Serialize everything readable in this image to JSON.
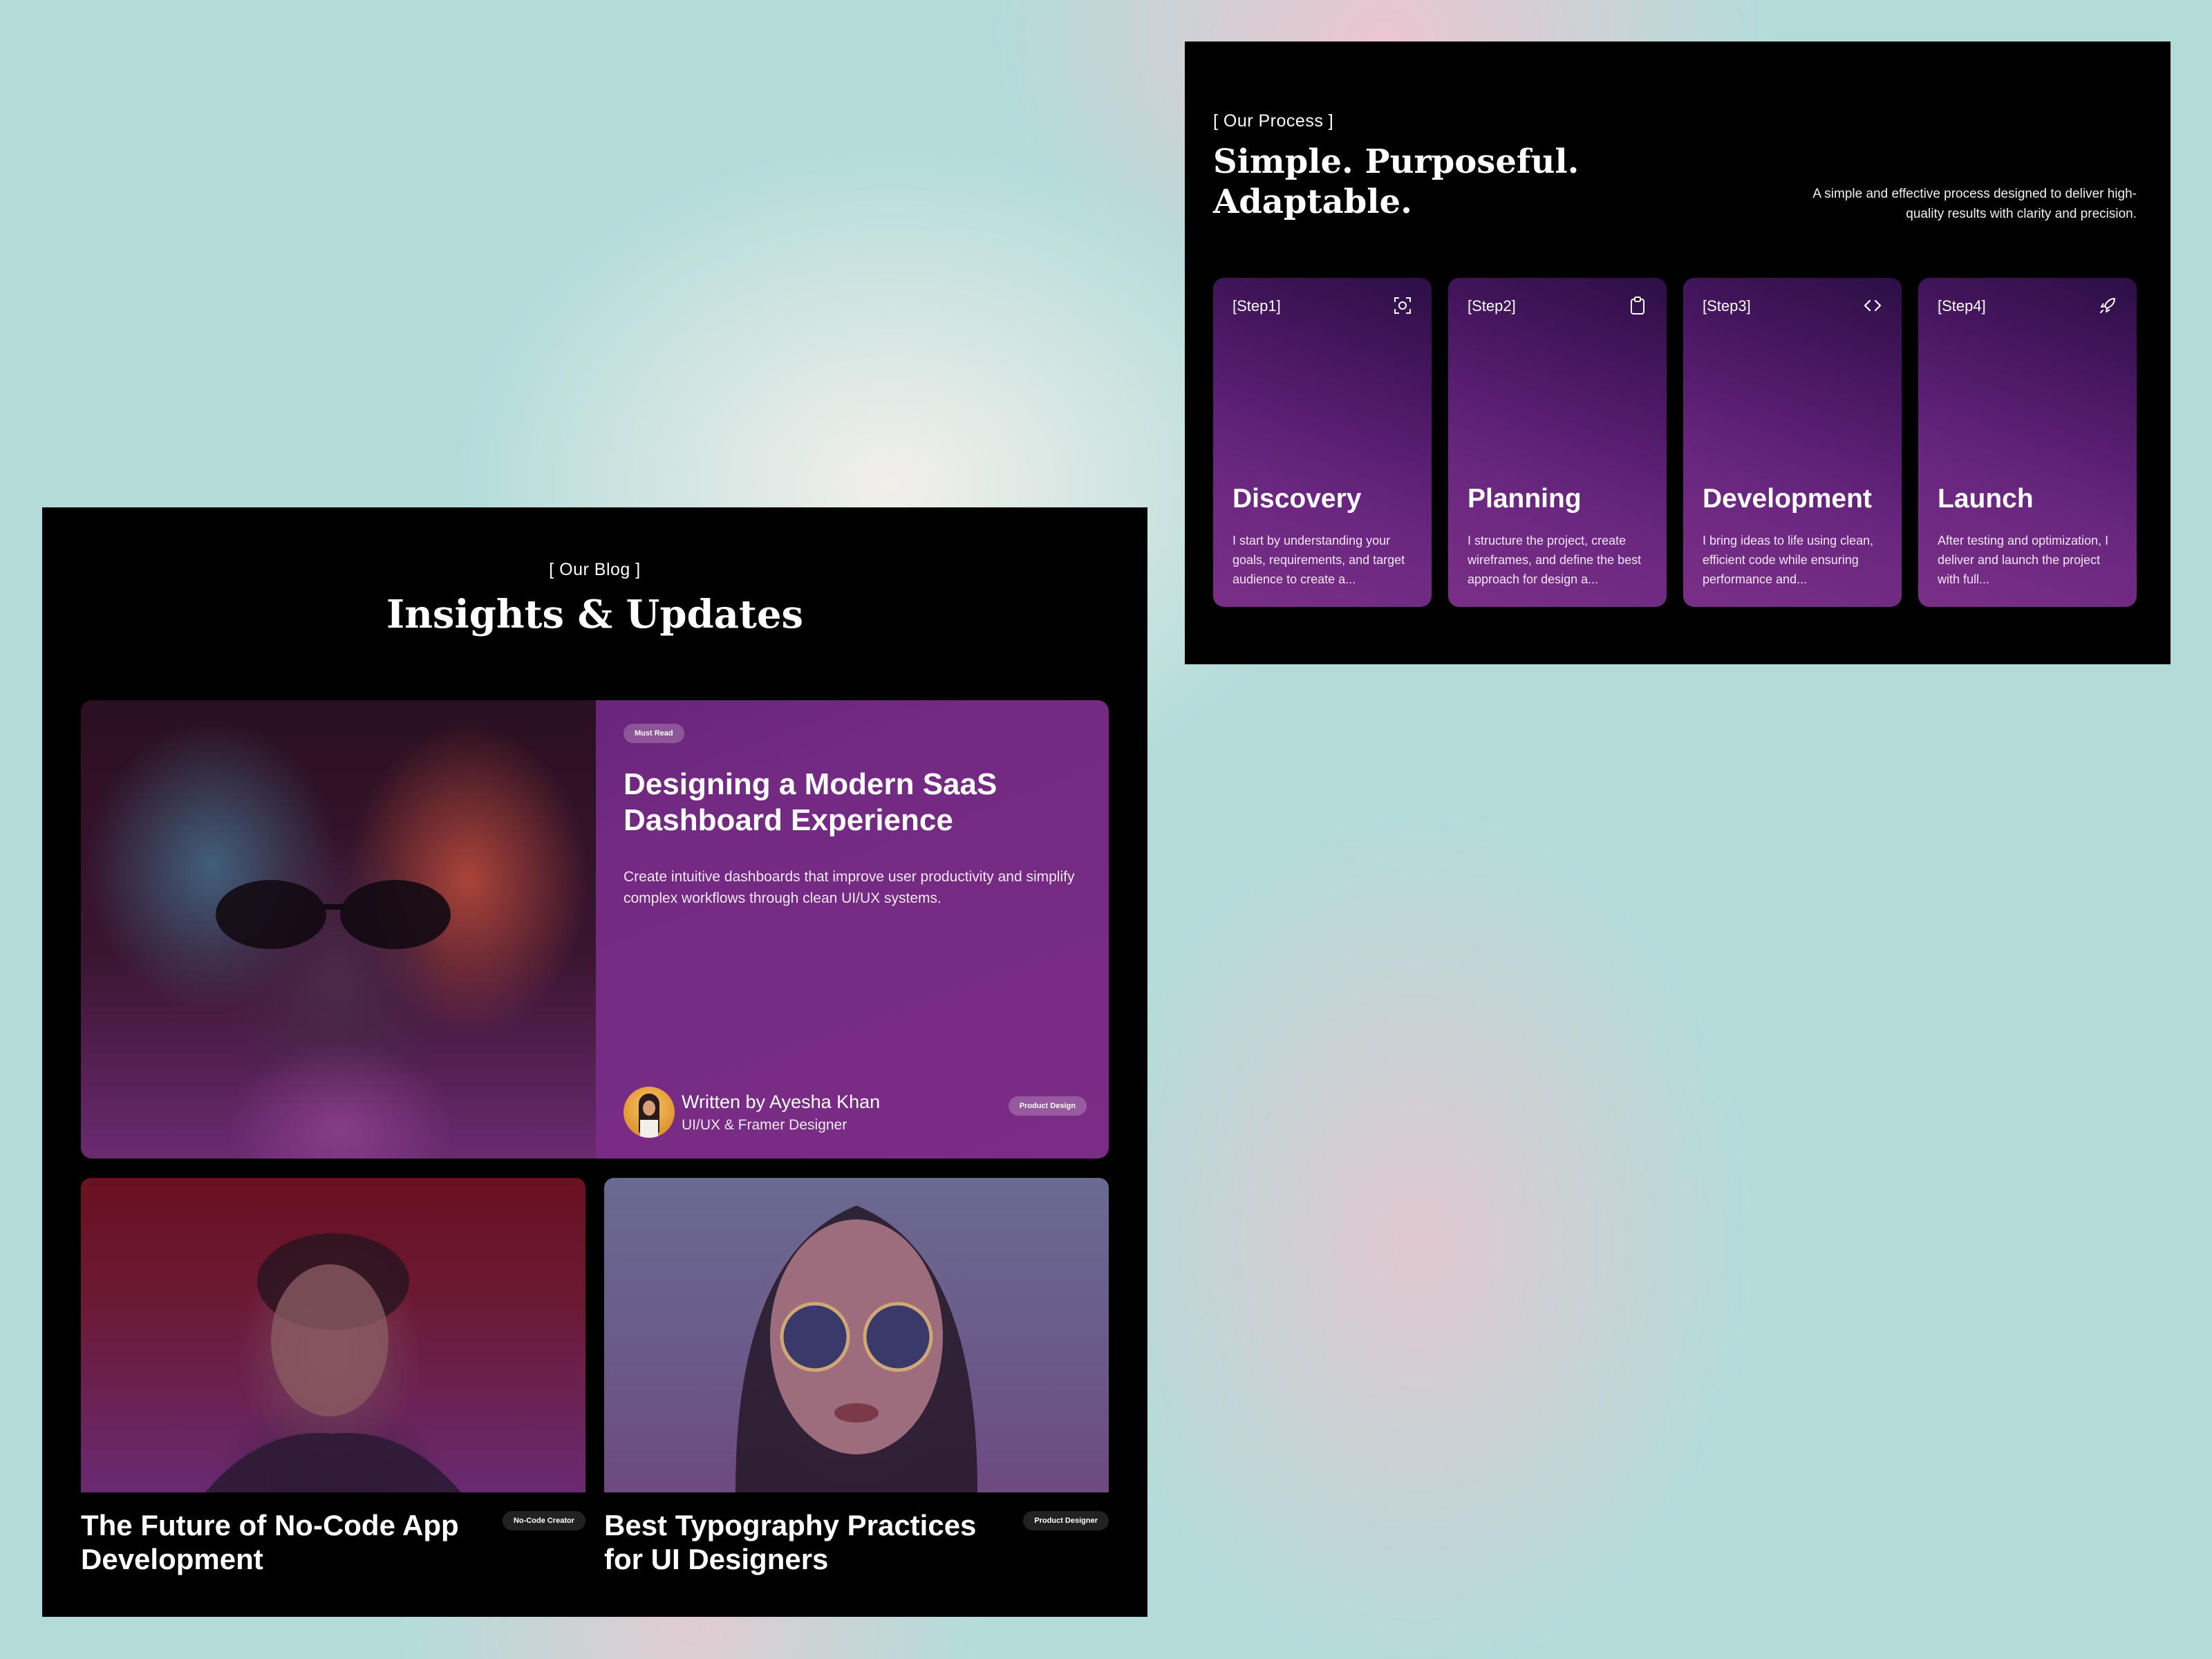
{
  "blog": {
    "tag": "[ Our Blog ]",
    "title": "Insights & Updates",
    "featured": {
      "badge": "Must Read",
      "title": "Designing a Modern SaaS Dashboard Experience",
      "description": "Create intuitive dashboards that improve user productivity and simplify complex workflows through clean UI/UX systems.",
      "author_name": "Written by Ayesha Khan",
      "author_role": "UI/UX & Framer Designer",
      "category": "Product Design"
    },
    "posts": [
      {
        "title": "The Future of No-Code App Development",
        "category": "No-Code Creator"
      },
      {
        "title": "Best Typography Practices for UI Designers",
        "category": "Product Designer"
      }
    ]
  },
  "process": {
    "tag": "[ Our Process ]",
    "title_line1": "Simple. Purposeful.",
    "title_line2": "Adaptable.",
    "description": "A simple and effective process designed to deliver high-quality results with clarity and precision.",
    "steps": [
      {
        "label": "[Step1]",
        "name": "Discovery",
        "icon": "scan-icon",
        "text": "I start by understanding your goals, requirements, and target audience to create a..."
      },
      {
        "label": "[Step2]",
        "name": "Planning",
        "icon": "clipboard-icon",
        "text": "I structure the project, create wireframes, and define the best approach for design a..."
      },
      {
        "label": "[Step3]",
        "name": "Development",
        "icon": "code-icon",
        "text": "I bring ideas to life using clean, efficient code while ensuring performance and..."
      },
      {
        "label": "[Step4]",
        "name": "Launch",
        "icon": "rocket-icon",
        "text": "After testing and optimization, I deliver and launch the project with full..."
      }
    ]
  }
}
